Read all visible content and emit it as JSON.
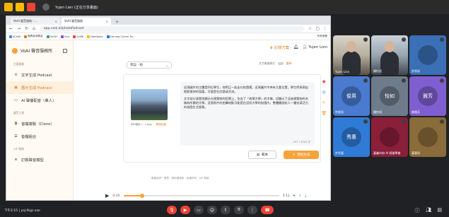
{
  "meet": {
    "title": "Yujen Lien (正在分享畫面)",
    "clock": "下午2:15 | yoj-fkgc-xze"
  },
  "browser": {
    "tabs": [
      {
        "label": "VoAI 聲音服務｜..."
      },
      {
        "label": "VoAI 聲音服務"
      }
    ],
    "url": "app.voai.ai/photoPodcast",
    "bookmarks": [
      "SCHW",
      "佛教慈濟基金",
      "SeiWi",
      "Vivo",
      "SeiWi",
      "Notebook",
      "Earning Center Fe..."
    ],
    "bookmarks_right": "所有書籤"
  },
  "app": {
    "brand": "VoAI 聲音服務所",
    "section_main": "主要服務",
    "items": [
      {
        "label": "文字生成 Podcast"
      },
      {
        "label": "圖片生成 Podcast"
      },
      {
        "label": "AI 聲優配音（單人）"
      }
    ],
    "section_voice": "聲音工具",
    "voice_items": [
      {
        "label": "音檔複製（Clone）"
      },
      {
        "label": "音檔組合"
      }
    ],
    "section_vip": "VIP 服務",
    "vip_items": [
      {
        "label": "訂製聲音模型"
      }
    ],
    "plan": "訂閱方案",
    "user": "Yujen Lien",
    "select_value": "預設 - 柏",
    "options_label": "文字檢查模式",
    "options_right": "重新",
    "thumb_caption": "IMG圖片 (...).png",
    "thumb_delete": "刪除此圖",
    "text_p1": "這張圖片的主體是四位學生，他們正一起走在校園裡。這張圖片中央有主要位置，學生們表現出輕鬆愉快的氛圍，可能是在討論或交流。",
    "text_p2": "文字部分清楚地顯示在建築物的招牌上，包含了「南華大學」的字樣，這顯示了這座建築物的名稱和所屬的大學。這張照片的拍攝地點可能是在這所大學的校園內，整體畫面給人一種充滿活力的校園生活感覺。",
    "char_count": "297 / 5000 字",
    "btn_sample": "範本",
    "btn_generate": "開始生成",
    "footer": "聯絡我們 · 服務 · 隱私權條款 · 版權所有 · API 服務",
    "time_start": "0:35",
    "time_end": "3:11",
    "progress": 0.12
  },
  "participants": [
    {
      "name": "Yujen Lien",
      "type": "video"
    },
    {
      "name": "陳怡君",
      "type": "video"
    },
    {
      "name": "許原成",
      "type": "avatar",
      "initial": "",
      "color": "#3b6fb6"
    },
    {
      "name": "許俊男",
      "type": "avatar",
      "initial": "俊男",
      "color": "#4a7bd0"
    },
    {
      "name": "陳怡如",
      "type": "avatar",
      "initial": "怡如",
      "color": "#6e7b8b"
    },
    {
      "name": "謝雅芳",
      "type": "avatar",
      "initial": "雅芳",
      "color": "#7f5fd0"
    },
    {
      "name": "許秀惠",
      "type": "avatar",
      "initial": "秀惠",
      "color": "#2f7bd6"
    },
    {
      "name": "嘉義市府 AI 經營學會",
      "type": "avatar",
      "initial": "",
      "color": "#8a1f3a"
    },
    {
      "name": "黃惠如",
      "type": "avatar",
      "initial": "",
      "color": "#8a6b3a"
    }
  ]
}
